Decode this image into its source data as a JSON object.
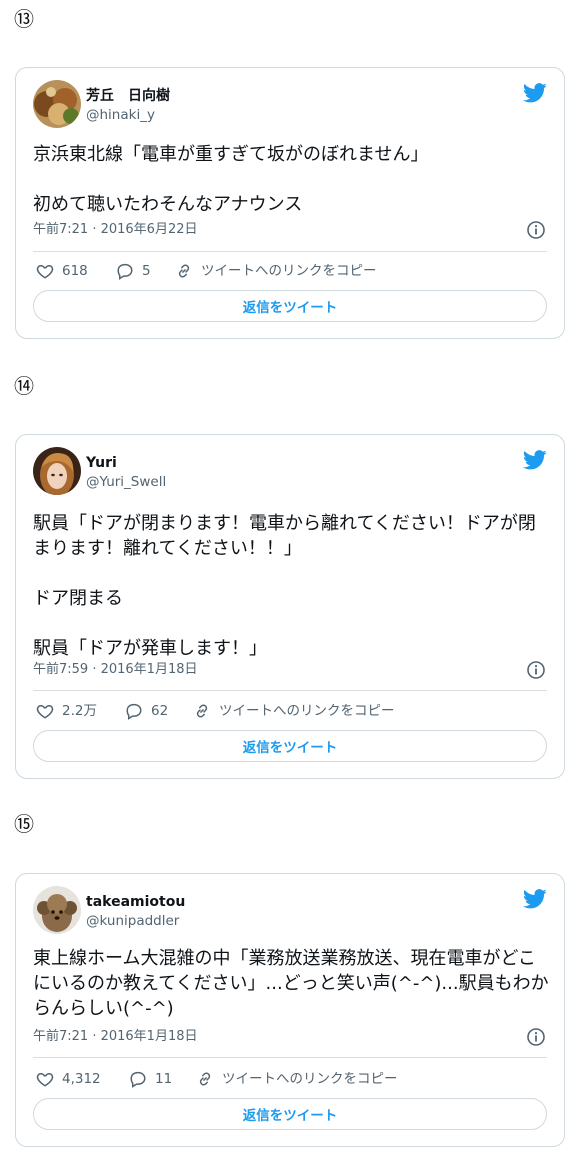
{
  "colors": {
    "accent": "#1d9bf0",
    "text": "#0f1419",
    "muted": "#536471",
    "border": "#cfd9de"
  },
  "icons": [
    "twitter-bird-icon",
    "info-icon",
    "heart-icon",
    "reply-bubble-icon",
    "link-icon"
  ],
  "tweets": [
    {
      "number": "⑬",
      "name": "芳丘　日向樹",
      "handle": "@hinaki_y",
      "lines": [
        "京浜東北線「電車が重すぎて坂がのぼれません」",
        "初めて聴いたわそんなアナウンス"
      ],
      "timestamp": "午前7:21 · 2016年6月22日",
      "likes": "618",
      "replies": "5",
      "copy_link": "ツイートへのリンクをコピー",
      "reply_button": "返信をツイート"
    },
    {
      "number": "⑭",
      "name": "Yuri",
      "handle": "@Yuri_Swell",
      "lines": [
        "駅員「ドアが閉まります！電車から離れてください！ドアが閉まります！離れてください！！」",
        "ドア閉まる",
        "駅員「ドアが発車します！」"
      ],
      "timestamp": "午前7:59 · 2016年1月18日",
      "likes": "2.2万",
      "replies": "62",
      "copy_link": "ツイートへのリンクをコピー",
      "reply_button": "返信をツイート"
    },
    {
      "number": "⑮",
      "name": "takeamiotou",
      "handle": "@kunipaddler",
      "lines": [
        "東上線ホーム大混雑の中「業務放送業務放送、現在電車がどこにいるのか教えてください」...どっと笑い声(^-^)...駅員もわからんらしい(^-^)"
      ],
      "timestamp": "午前7:21 · 2016年1月18日",
      "likes": "4,312",
      "replies": "11",
      "copy_link": "ツイートへのリンクをコピー",
      "reply_button": "返信をツイート"
    }
  ]
}
